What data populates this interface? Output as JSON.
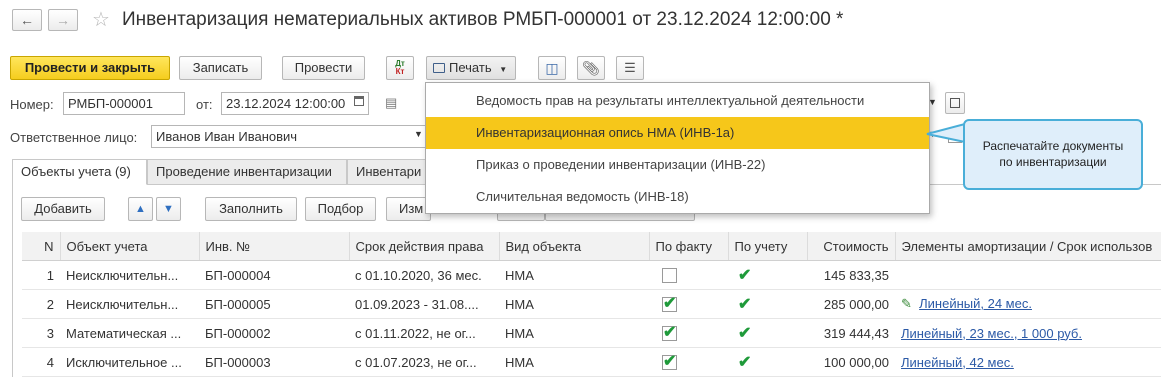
{
  "title": "Инвентаризация нематериальных активов РМБП-000001 от 23.12.2024 12:00:00 *",
  "toolbar": {
    "post_close": "Провести и закрыть",
    "save": "Записать",
    "post": "Провести",
    "print": "Печать",
    "dtkt_top": "Дт",
    "dtkt_bottom": "Кт"
  },
  "form": {
    "number_label": "Номер:",
    "number_value": "РМБП-000001",
    "date_label": "от:",
    "date_value": "23.12.2024 12:00:00",
    "responsible_label": "Ответственное лицо:",
    "responsible_value": "Иванов Иван Иванович"
  },
  "tabs": [
    {
      "label": "Объекты учета (9)"
    },
    {
      "label": "Проведение инвентаризации"
    },
    {
      "label": "Инвентари"
    }
  ],
  "tab_toolbar": {
    "add": "Добавить",
    "fill": "Заполнить",
    "select": "Подбор",
    "change": "Изм"
  },
  "table": {
    "columns": [
      "N",
      "Объект учета",
      "Инв. №",
      "Срок действия права",
      "Вид объекта",
      "По факту",
      "По учету",
      "Стоимость",
      "Элементы амортизации / Срок использов"
    ],
    "rows": [
      {
        "n": "1",
        "object": "Неисключительн...",
        "inv": "БП-000004",
        "term": "с 01.10.2020, 36 мес.",
        "kind": "НМА",
        "fact": false,
        "account": true,
        "cost": "145 833,35",
        "amort": "",
        "pencil": false
      },
      {
        "n": "2",
        "object": "Неисключительн...",
        "inv": "БП-000005",
        "term": "01.09.2023 - 31.08....",
        "kind": "НМА",
        "fact": true,
        "account": true,
        "cost": "285 000,00",
        "amort": "Линейный, 24 мес.",
        "pencil": true
      },
      {
        "n": "3",
        "object": "Математическая ...",
        "inv": "БП-000002",
        "term": "с 01.11.2022, не ог...",
        "kind": "НМА",
        "fact": true,
        "account": true,
        "cost": "319 444,43",
        "amort": "Линейный, 23 мес., 1 000 руб.",
        "pencil": false
      },
      {
        "n": "4",
        "object": "Исключительное ...",
        "inv": "БП-000003",
        "term": "с 01.07.2023, не ог...",
        "kind": "НМА",
        "fact": true,
        "account": true,
        "cost": "100 000,00",
        "amort": "Линейный, 42 мес.",
        "pencil": false
      }
    ]
  },
  "print_menu": {
    "items": [
      {
        "label": "Ведомость прав на результаты интеллектуальной деятельности",
        "highlighted": false
      },
      {
        "label": "Инвентаризационная опись НМА (ИНВ-1а)",
        "highlighted": true
      },
      {
        "label": "Приказ о проведении инвентаризации (ИНВ-22)",
        "highlighted": false
      },
      {
        "label": "Сличительная ведомость (ИНВ-18)",
        "highlighted": false
      }
    ],
    "highlight_color": "#f6c71a"
  },
  "tooltip": {
    "line1": "Распечатайте документы",
    "line2": "по инвентаризации"
  }
}
